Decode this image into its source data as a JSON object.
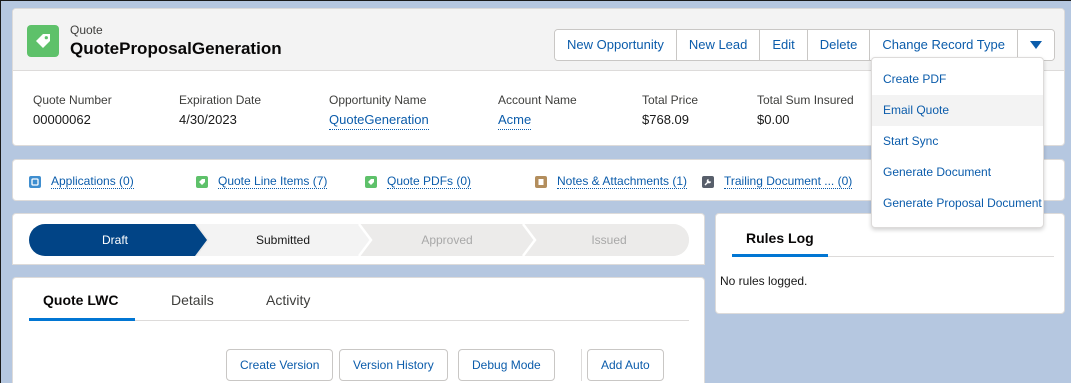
{
  "header": {
    "object_type": "Quote",
    "record_title": "QuoteProposalGeneration",
    "buttons": [
      "New Opportunity",
      "New Lead",
      "Edit",
      "Delete",
      "Change Record Type"
    ]
  },
  "fields": [
    {
      "label": "Quote Number",
      "value": "00000062",
      "link": false
    },
    {
      "label": "Expiration Date",
      "value": "4/30/2023",
      "link": false
    },
    {
      "label": "Opportunity Name",
      "value": "QuoteGeneration",
      "link": true
    },
    {
      "label": "Account Name",
      "value": "Acme",
      "link": true
    },
    {
      "label": "Total Price",
      "value": "$768.09",
      "link": false
    },
    {
      "label": "Total Sum Insured",
      "value": "$0.00",
      "link": false
    }
  ],
  "dropdown": {
    "items": [
      "Create PDF",
      "Email Quote",
      "Start Sync",
      "Generate Document",
      "Generate Proposal Document"
    ],
    "highlighted_index": 1
  },
  "related": [
    {
      "label": "Applications (0)",
      "icon": "application-icon",
      "color": "#3f8ecf"
    },
    {
      "label": "Quote Line Items (7)",
      "icon": "quote-icon",
      "color": "#5ec16a"
    },
    {
      "label": "Quote PDFs (0)",
      "icon": "quote-icon",
      "color": "#5ec16a"
    },
    {
      "label": "Notes & Attachments (1)",
      "icon": "notes-icon",
      "color": "#b38e5d"
    },
    {
      "label": "Trailing Document ... (0)",
      "icon": "wrench-icon",
      "color": "#585f6b"
    }
  ],
  "path": {
    "stages": [
      "Draft",
      "Submitted",
      "Approved",
      "Issued"
    ],
    "current_index": 0,
    "completed_index": 1
  },
  "tabs": {
    "items": [
      "Quote LWC",
      "Details",
      "Activity"
    ],
    "active_index": 0
  },
  "actions": [
    "Create Version",
    "Version History",
    "Debug Mode",
    "Add Auto"
  ],
  "rules_log": {
    "title": "Rules Log",
    "empty_message": "No rules logged."
  },
  "colors": {
    "brand_blue": "#0b5cab",
    "active_stage": "#014486",
    "quote_green": "#5ec16a"
  }
}
